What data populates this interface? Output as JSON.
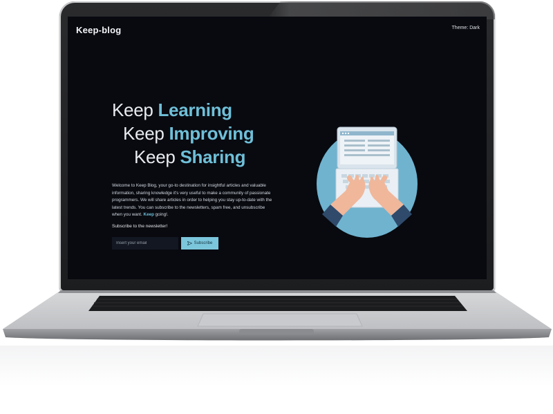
{
  "site": {
    "brand": "Keep-blog",
    "theme_toggle": "Theme: Dark"
  },
  "hero": {
    "line1_prefix": "Keep",
    "line1_accent": "Learning",
    "line2_prefix": "Keep",
    "line2_accent": "Improving",
    "line3_prefix": "Keep",
    "line3_accent": "Sharing"
  },
  "intro": {
    "text": "Welcome to Keep Blog, your go-to destination for insightful articles and valuable information, sharing knowledge it's very useful to make a community of passionate programmers. We will share articles in order to helping you stay up-to-date with the latest trends. You can subscribe to the newsletters, spam free, and unsubscribe when you want.",
    "keep_word": "Keep",
    "tail": "going!."
  },
  "newsletter": {
    "label": "Subscribe to the newsletter!",
    "email_placeholder": "Insert your email",
    "email_value": "",
    "subscribe_label": "Subscribe",
    "subscribe_icon": "send-icon"
  },
  "illustration": {
    "icon": "laptop-typing-icon"
  },
  "colors": {
    "accent": "#6fbfd8",
    "background": "#080a10",
    "button": "#7cc6dc"
  }
}
